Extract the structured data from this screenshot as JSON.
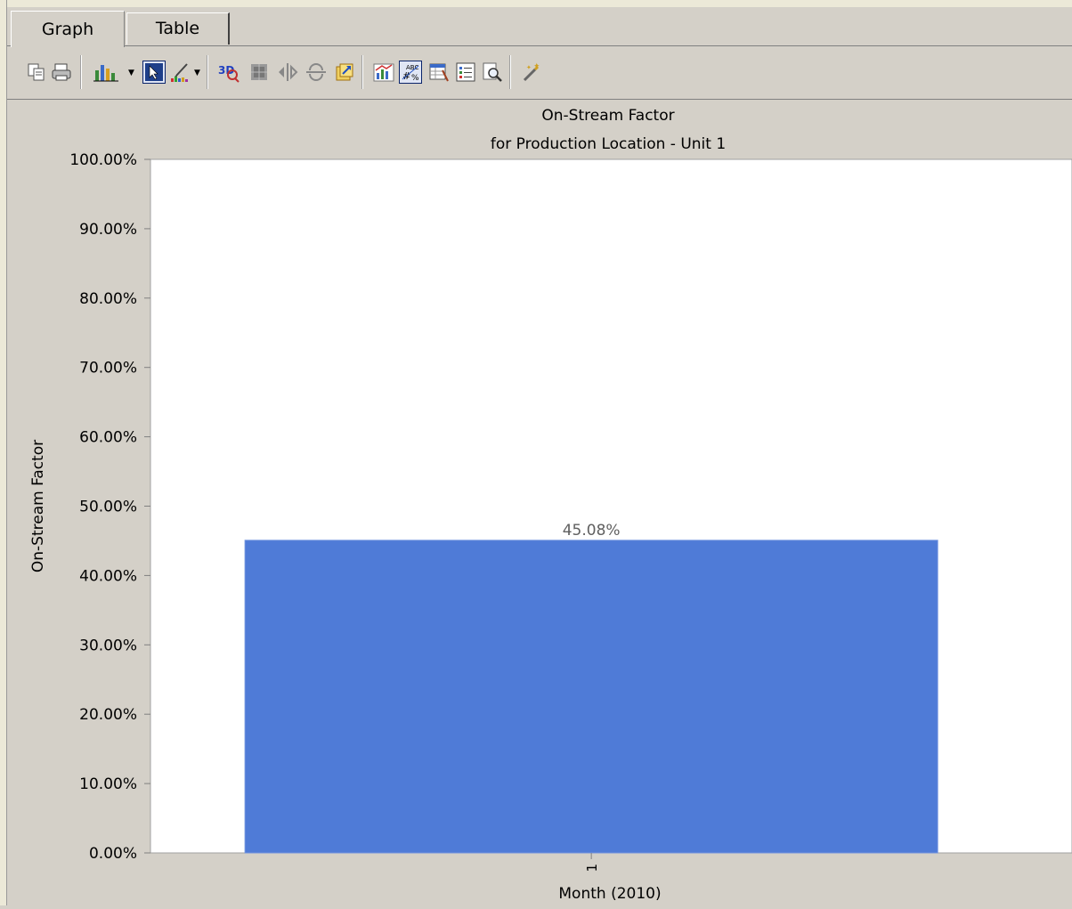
{
  "tabs": [
    {
      "label": "Graph",
      "active": true
    },
    {
      "label": "Table",
      "active": false
    }
  ],
  "toolbar": {
    "icons": [
      "copy-icon",
      "print-icon",
      "bar-chart-type-icon",
      "chart-type-dropdown-icon",
      "select-pointer-icon",
      "palette-icon",
      "palette-dropdown-icon",
      "3d-view-icon",
      "grid-icon",
      "rotate-horizontal-icon",
      "rotate-vertical-icon",
      "export-icon",
      "axis-settings-icon",
      "point-labels-icon",
      "data-editor-icon",
      "legend-icon",
      "zoom-icon",
      "wizard-icon"
    ]
  },
  "chart_data": {
    "type": "bar",
    "title": "On-Stream Factor",
    "subtitle": "for Production Location - Unit 1",
    "xlabel": "Month (2010)",
    "ylabel": "On-Stream Factor",
    "categories": [
      "1"
    ],
    "values": [
      45.08
    ],
    "value_labels": [
      "45.08%"
    ],
    "ylim": [
      0,
      100
    ],
    "yticks": [
      "0.00%",
      "10.00%",
      "20.00%",
      "30.00%",
      "40.00%",
      "50.00%",
      "60.00%",
      "70.00%",
      "80.00%",
      "90.00%",
      "100.00%"
    ],
    "bar_color": "#4f7bd7",
    "grid": false,
    "legend": "none"
  }
}
